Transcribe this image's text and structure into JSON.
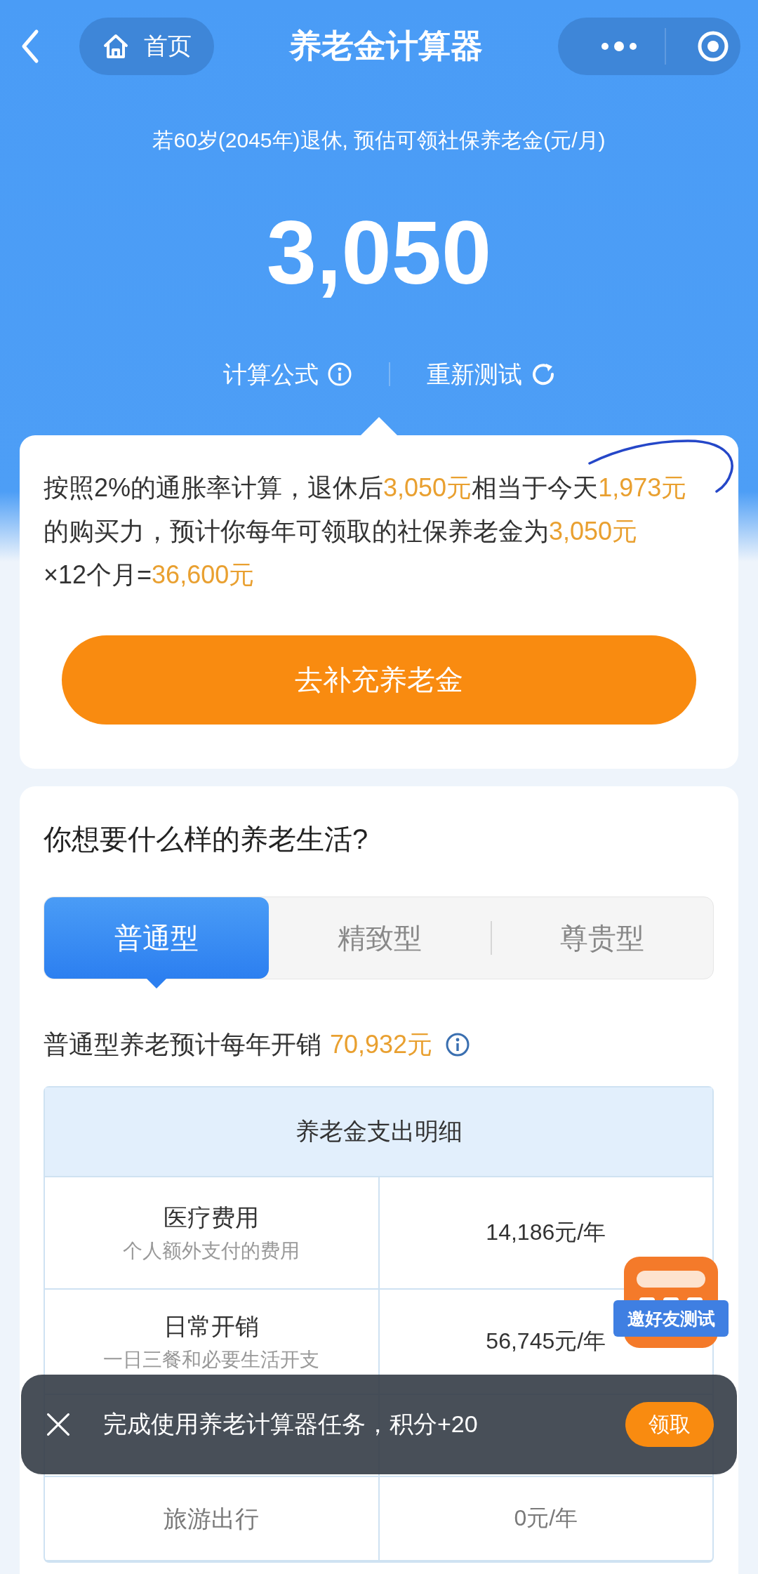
{
  "nav": {
    "home_label": "首页",
    "title": "养老金计算器"
  },
  "summary": {
    "caption": "若60岁(2045年)退休, 预估可领社保养老金(元/月)",
    "amount": "3,050",
    "links": [
      {
        "label": "计算公式",
        "kind": "info"
      },
      {
        "label": "重新测试",
        "kind": "refresh"
      }
    ]
  },
  "explanation": {
    "segments": [
      {
        "text": "按照2%的通胀率计算，退休后",
        "highlight": false
      },
      {
        "text": "3,050元",
        "highlight": true
      },
      {
        "text": "相当于今天",
        "highlight": false
      },
      {
        "text": "1,973元",
        "highlight": true
      },
      {
        "text": "的购买力，预计你每年可领取的社保养老金为",
        "highlight": false
      },
      {
        "text": "3,050元",
        "highlight": true
      },
      {
        "text": "×12个月=",
        "highlight": false
      },
      {
        "text": "36,600元",
        "highlight": true
      }
    ],
    "button": "去补充养老金"
  },
  "lifestyle": {
    "question": "你想要什么样的养老生活?",
    "tabs": [
      {
        "label": "普通型",
        "selected": true
      },
      {
        "label": "精致型",
        "selected": false
      },
      {
        "label": "尊贵型",
        "selected": false
      }
    ],
    "estimate": {
      "label": "普通型养老预计每年开销",
      "amount": "70,932元"
    },
    "table": {
      "title": "养老金支出明细",
      "rows": [
        {
          "kind": "entry",
          "item": "医疗费用",
          "note": "个人额外支付的费用",
          "amount": "14,186元/年",
          "muted": false
        },
        {
          "kind": "entry",
          "item": "日常开销",
          "note": "一日三餐和必要生活开支",
          "amount": "56,745元/年",
          "muted": false
        },
        {
          "kind": "covered"
        },
        {
          "kind": "entry",
          "item": "旅游出行",
          "amount": "0元/年",
          "muted": true
        }
      ]
    }
  },
  "invite_badge": "邀好友测试",
  "toast": {
    "message": "完成使用养老计算器任务，积分+20",
    "action": "领取"
  }
}
